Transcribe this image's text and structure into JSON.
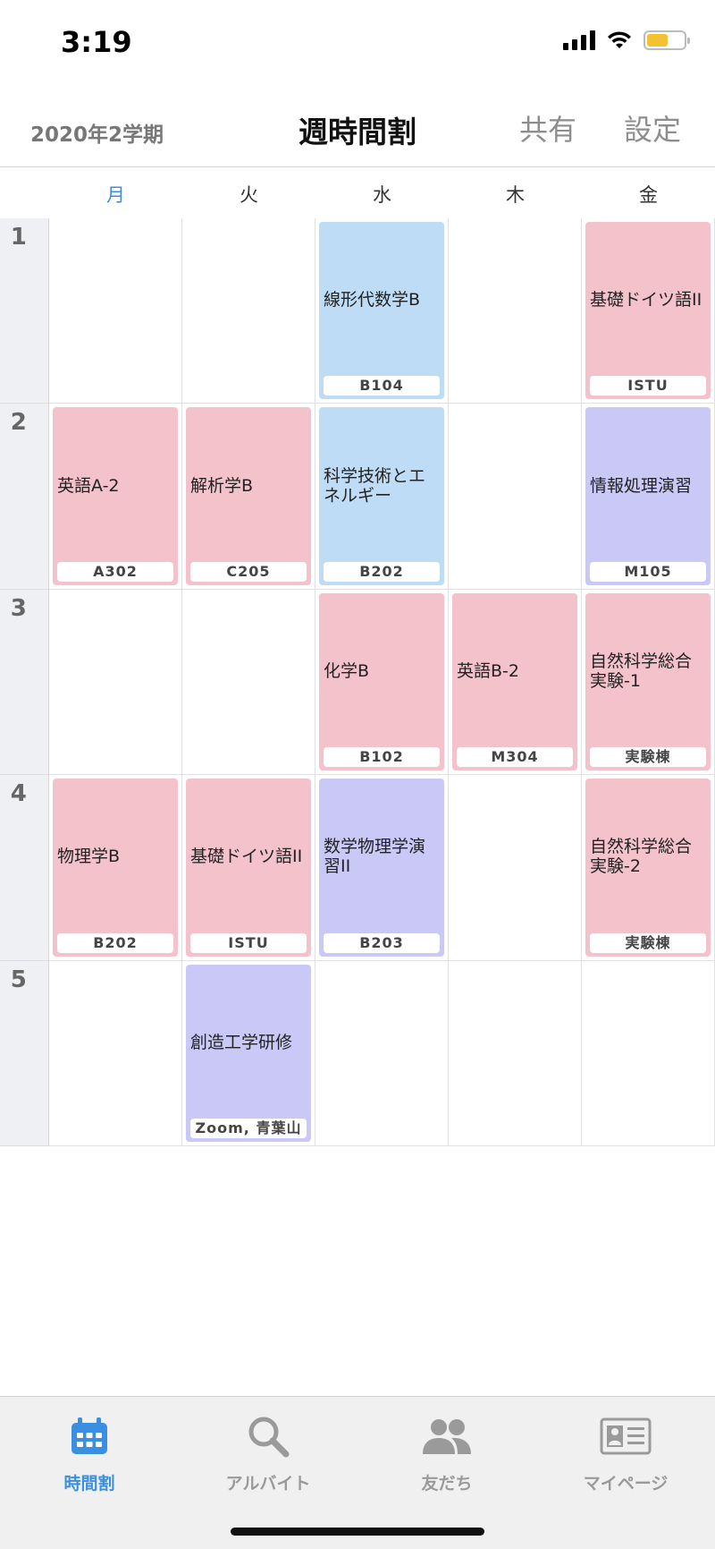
{
  "status": {
    "time": "3:19"
  },
  "header": {
    "term": "2020年2学期",
    "title": "週時間割",
    "share": "共有",
    "settings": "設定"
  },
  "days": [
    "月",
    "火",
    "水",
    "木",
    "金"
  ],
  "active_day": 0,
  "periods": [
    "1",
    "2",
    "3",
    "4",
    "5"
  ],
  "courses": [
    {
      "day": 2,
      "period": 0,
      "name": "線形代数学B",
      "room": "B104",
      "color": "blue"
    },
    {
      "day": 4,
      "period": 0,
      "name": "基礎ドイツ語II",
      "room": "ISTU",
      "color": "pink"
    },
    {
      "day": 0,
      "period": 1,
      "name": "英語A-2",
      "room": "A302",
      "color": "pink"
    },
    {
      "day": 1,
      "period": 1,
      "name": "解析学B",
      "room": "C205",
      "color": "pink"
    },
    {
      "day": 2,
      "period": 1,
      "name": "科学技術とエネルギー",
      "room": "B202",
      "color": "blue"
    },
    {
      "day": 4,
      "period": 1,
      "name": "情報処理演習",
      "room": "M105",
      "color": "purple"
    },
    {
      "day": 2,
      "period": 2,
      "name": "化学B",
      "room": "B102",
      "color": "pink"
    },
    {
      "day": 3,
      "period": 2,
      "name": "英語B-2",
      "room": "M304",
      "color": "pink"
    },
    {
      "day": 4,
      "period": 2,
      "name": "自然科学総合実験-1",
      "room": "実験棟",
      "color": "pink"
    },
    {
      "day": 0,
      "period": 3,
      "name": "物理学B",
      "room": "B202",
      "color": "pink"
    },
    {
      "day": 1,
      "period": 3,
      "name": "基礎ドイツ語II",
      "room": "ISTU",
      "color": "pink"
    },
    {
      "day": 2,
      "period": 3,
      "name": "数学物理学演習II",
      "room": "B203",
      "color": "purple"
    },
    {
      "day": 4,
      "period": 3,
      "name": "自然科学総合実験-2",
      "room": "実験棟",
      "color": "pink"
    },
    {
      "day": 1,
      "period": 4,
      "name": "創造工学研修",
      "room": "Zoom, 青葉山",
      "color": "purple"
    }
  ],
  "tabs": [
    {
      "label": "時間割",
      "icon": "calendar-icon",
      "active": true
    },
    {
      "label": "アルバイト",
      "icon": "search-icon",
      "active": false
    },
    {
      "label": "友だち",
      "icon": "friends-icon",
      "active": false
    },
    {
      "label": "マイページ",
      "icon": "id-card-icon",
      "active": false
    }
  ],
  "colors": {
    "accent": "#3b8fe0",
    "pink": "#f4c2cb",
    "blue": "#bfdcf6",
    "purple": "#c9c8f6"
  }
}
